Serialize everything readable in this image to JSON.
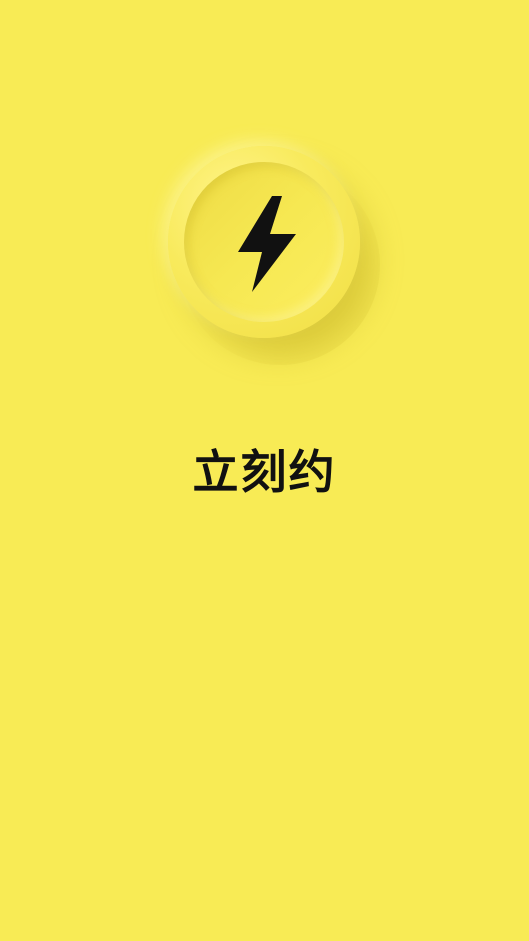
{
  "app": {
    "name": "立刻约",
    "background_color": "#F8EB55",
    "accent_color": "#111111"
  },
  "logo": {
    "icon": "lightning-bolt-icon"
  }
}
